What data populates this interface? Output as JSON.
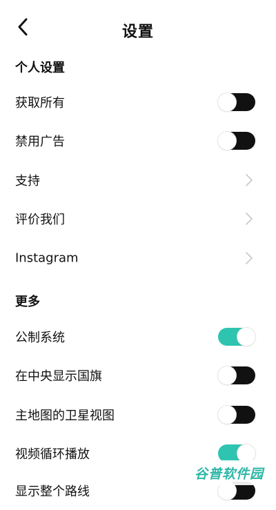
{
  "header": {
    "title": "设置",
    "back_icon": "chevron-left-icon"
  },
  "sections": [
    {
      "title": "个人设置",
      "rows": [
        {
          "label": "获取所有",
          "control": "toggle",
          "state": "off"
        },
        {
          "label": "禁用广告",
          "control": "toggle",
          "state": "off"
        },
        {
          "label": "支持",
          "control": "chevron"
        },
        {
          "label": "评价我们",
          "control": "chevron"
        },
        {
          "label": "Instagram",
          "control": "chevron"
        }
      ]
    },
    {
      "title": "更多",
      "rows": [
        {
          "label": "公制系统",
          "control": "toggle",
          "state": "on"
        },
        {
          "label": "在中央显示国旗",
          "control": "toggle",
          "state": "off"
        },
        {
          "label": "主地图的卫星视图",
          "control": "toggle",
          "state": "off"
        },
        {
          "label": "视频循环播放",
          "control": "toggle",
          "state": "on"
        },
        {
          "label": "显示整个路线",
          "control": "toggle",
          "state": "off"
        }
      ]
    }
  ],
  "colors": {
    "toggle_on": "#2ec4b0",
    "toggle_off": "#111111",
    "chevron": "#c8c8c8"
  },
  "watermark": {
    "text": "谷普软件园"
  }
}
